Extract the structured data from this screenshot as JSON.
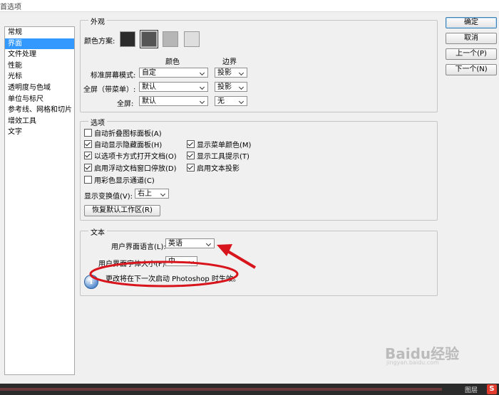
{
  "window": {
    "title": "首选项"
  },
  "sidebar": {
    "items": [
      {
        "label": "常规"
      },
      {
        "label": "界面"
      },
      {
        "label": "文件处理"
      },
      {
        "label": "性能"
      },
      {
        "label": "光标"
      },
      {
        "label": "透明度与色域"
      },
      {
        "label": "单位与标尺"
      },
      {
        "label": "参考线、网格和切片"
      },
      {
        "label": "增效工具"
      },
      {
        "label": "文字"
      }
    ],
    "selected": "界面"
  },
  "buttons": {
    "ok": "确定",
    "cancel": "取消",
    "prev": "上一个(P)",
    "next": "下一个(N)"
  },
  "appearance": {
    "title": "外观",
    "color_scheme_label": "颜色方案:",
    "swatches": [
      {
        "color": "#2c2c2c"
      },
      {
        "color": "#555555"
      },
      {
        "color": "#b6b6b6"
      },
      {
        "color": "#dedede"
      }
    ],
    "col_color": "颜色",
    "col_border": "边界",
    "rows": [
      {
        "label": "标准屏幕模式:",
        "color": "自定",
        "border": "投影"
      },
      {
        "label": "全屏（带菜单）:",
        "color": "默认",
        "border": "投影"
      },
      {
        "label": "全屏:",
        "color": "默认",
        "border": "无"
      }
    ]
  },
  "options": {
    "title": "选项",
    "checkboxes": [
      {
        "label": "自动折叠图标面板(A)",
        "checked": false
      },
      {
        "label": "自动显示隐藏面板(H)",
        "checked": true
      },
      {
        "label": "以选项卡方式打开文档(O)",
        "checked": true
      },
      {
        "label": "启用浮动文档窗口停放(D)",
        "checked": true
      },
      {
        "label": "用彩色显示通道(C)",
        "checked": false
      },
      {
        "label": "显示菜单颜色(M)",
        "checked": true
      },
      {
        "label": "显示工具提示(T)",
        "checked": true
      },
      {
        "label": "启用文本投影",
        "checked": true
      }
    ],
    "transform_label": "显示变换值(V):",
    "transform_value": "右上",
    "restore_button": "恢复默认工作区(R)"
  },
  "text": {
    "title": "文本",
    "lang_label": "用户界面语言(L):",
    "lang_value": "英语",
    "font_label": "用户界面字体大小(F):",
    "font_value": "中",
    "notice": "更改将在下一次启动 Photoshop 时生效。"
  },
  "taskbar": {
    "layers": "图层"
  },
  "watermark": {
    "brand": "Baidu经验",
    "url": "jingyan.baidu.com"
  }
}
